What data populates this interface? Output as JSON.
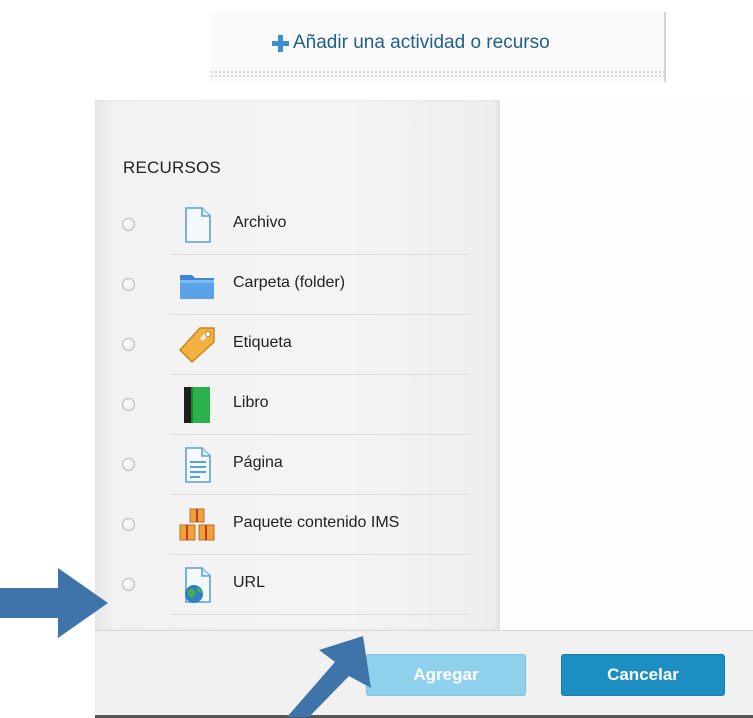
{
  "top_link": {
    "label": "Añadir una actividad o recurso",
    "icon": "plus-icon"
  },
  "dialog": {
    "section_title": "RECURSOS",
    "options": [
      {
        "label": "Archivo",
        "icon": "file-icon",
        "selected": false
      },
      {
        "label": "Carpeta (folder)",
        "icon": "folder-icon",
        "selected": false
      },
      {
        "label": "Etiqueta",
        "icon": "tag-icon",
        "selected": false
      },
      {
        "label": "Libro",
        "icon": "book-icon",
        "selected": false
      },
      {
        "label": "Página",
        "icon": "page-icon",
        "selected": false
      },
      {
        "label": "Paquete contenido IMS",
        "icon": "ims-package-icon",
        "selected": false
      },
      {
        "label": "URL",
        "icon": "url-globe-icon",
        "selected": false
      }
    ],
    "buttons": {
      "add_label": "Agregar",
      "cancel_label": "Cancelar"
    }
  },
  "colors": {
    "link": "#1f5f8b",
    "add_button": "#8fd0ec",
    "cancel_button": "#1d8ec2",
    "annotation_arrow": "#3f74aa"
  }
}
